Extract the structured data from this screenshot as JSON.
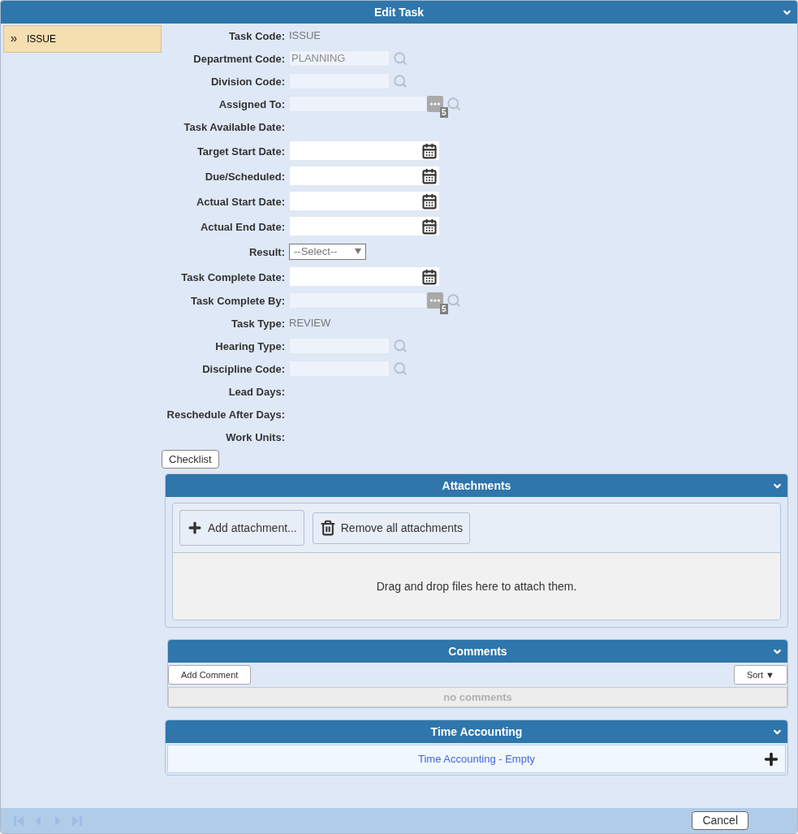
{
  "window": {
    "title": "Edit Task"
  },
  "sidebar": {
    "items": [
      {
        "label": "ISSUE",
        "selected": true
      }
    ]
  },
  "fields": [
    {
      "label": "Task Code:",
      "kind": "text",
      "value": "ISSUE"
    },
    {
      "label": "Department Code:",
      "kind": "lookup",
      "value": "PLANNING"
    },
    {
      "label": "Division Code:",
      "kind": "lookup"
    },
    {
      "label": "Assigned To:",
      "kind": "picker",
      "badge": "5"
    },
    {
      "label": "Task Available Date:",
      "kind": "text"
    },
    {
      "label": "Target Start Date:",
      "kind": "date"
    },
    {
      "label": "Due/Scheduled:",
      "kind": "date"
    },
    {
      "label": "Actual Start Date:",
      "kind": "date"
    },
    {
      "label": "Actual End Date:",
      "kind": "date"
    },
    {
      "label": "Result:",
      "kind": "select",
      "placeholder": "--Select--"
    },
    {
      "label": "Task Complete Date:",
      "kind": "date"
    },
    {
      "label": "Task Complete By:",
      "kind": "picker",
      "badge": "5"
    },
    {
      "label": "Task Type:",
      "kind": "text",
      "value": "REVIEW"
    },
    {
      "label": "Hearing Type:",
      "kind": "lookup"
    },
    {
      "label": "Discipline Code:",
      "kind": "lookup"
    },
    {
      "label": "Lead Days:",
      "kind": "text"
    },
    {
      "label": "Reschedule After Days:",
      "kind": "text"
    },
    {
      "label": "Work Units:",
      "kind": "text"
    }
  ],
  "checklist_button": "Checklist",
  "attachments": {
    "title": "Attachments",
    "buttons": [
      {
        "label": "Add attachment...",
        "kind": "add"
      },
      {
        "label": "Remove all attachments",
        "kind": "remove"
      }
    ],
    "drop_hint": "Drag and drop files here to attach them."
  },
  "comments": {
    "title": "Comments",
    "add_button": "Add Comment",
    "sort_button": "Sort ▼",
    "empty": "no comments"
  },
  "time_accounting": {
    "title": "Time Accounting",
    "empty": "Time Accounting - Empty"
  },
  "pager": [
    {
      "kind": "first",
      "disabled": true
    },
    {
      "kind": "prev",
      "disabled": true
    },
    {
      "kind": "next",
      "disabled": true
    },
    {
      "kind": "last",
      "disabled": true
    }
  ],
  "footer_buttons": [
    "Cancel"
  ]
}
